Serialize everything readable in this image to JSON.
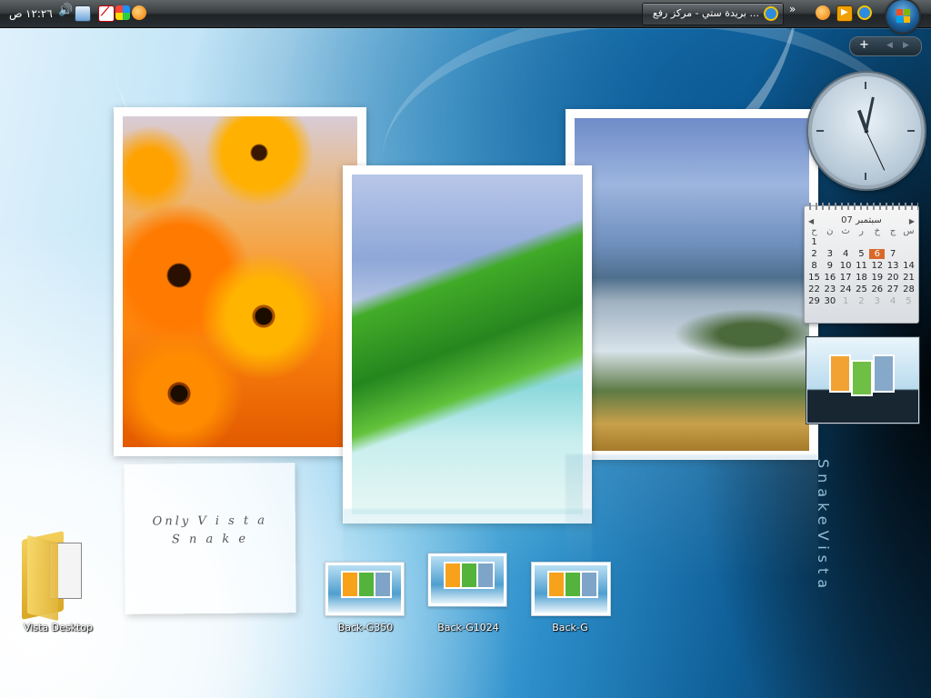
{
  "taskbar": {
    "clock_time": "١٢:٢٦",
    "clock_ampm": "ص",
    "window_button_label": "بريدة ستي - مركز رفع ...",
    "overflow_chevron": "»"
  },
  "sidebar": {
    "controls": {
      "add": "+",
      "prev": "◀",
      "next": "▶"
    },
    "calendar": {
      "header": "سبتمبر 07",
      "nav_prev": "◀",
      "nav_next": "▶",
      "weekdays": [
        "ح",
        "ن",
        "ث",
        "ر",
        "خ",
        "ج",
        "س"
      ],
      "rows": [
        [
          "1",
          "",
          "",
          "",
          "",
          "",
          ""
        ],
        [
          "2",
          "3",
          "4",
          "5",
          "6",
          "7",
          ""
        ],
        [
          "8",
          "9",
          "10",
          "11",
          "12",
          "13",
          "14"
        ],
        [
          "15",
          "16",
          "17",
          "18",
          "19",
          "20",
          "21"
        ],
        [
          "22",
          "23",
          "24",
          "25",
          "26",
          "27",
          "28"
        ],
        [
          "29",
          "30",
          "1",
          "2",
          "3",
          "4",
          "5"
        ]
      ],
      "today": "6"
    }
  },
  "wallpaper": {
    "note_line1": "Only V i s t a",
    "note_line2": "S n a k e",
    "side_text": "SnakeVista"
  },
  "desktop_icons": [
    {
      "label": "Vista Desktop"
    },
    {
      "label": "Back-G350"
    },
    {
      "label": "Back-G1024"
    },
    {
      "label": "Back-G"
    }
  ],
  "colors": {
    "taskbar": "#2a2f33",
    "calendar_today": "#d9692a",
    "label_text": "#ffffff"
  }
}
